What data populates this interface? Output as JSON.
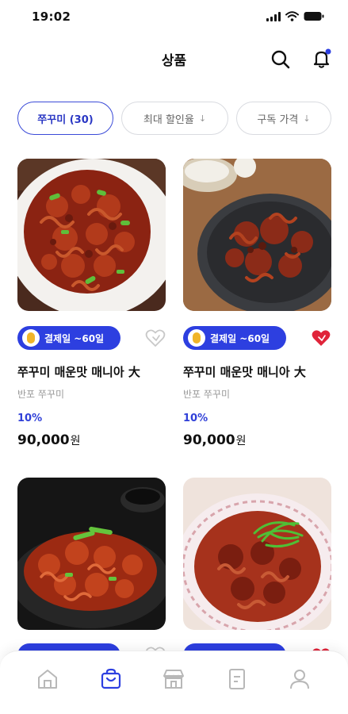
{
  "status_bar": {
    "time": "19:02"
  },
  "header": {
    "title": "상품"
  },
  "filters": [
    {
      "label": "쭈꾸미 (30)",
      "active": true
    },
    {
      "label": "최대 할인율",
      "active": false,
      "has_arrow": true
    },
    {
      "label": "구독 가격",
      "active": false,
      "has_arrow": true
    }
  ],
  "products": [
    {
      "badge": "결제일 ~60일",
      "liked": false,
      "name": "쭈꾸미 매운맛 매니아 大",
      "brand": "반포 쭈꾸미",
      "discount": "10%",
      "price": "90,000",
      "price_unit": "원"
    },
    {
      "badge": "결제일 ~60일",
      "liked": true,
      "name": "쭈꾸미 매운맛 매니아 大",
      "brand": "반포 쭈꾸미",
      "discount": "10%",
      "price": "90,000",
      "price_unit": "원"
    },
    {
      "liked": false
    },
    {
      "liked": true
    }
  ],
  "tabbar": {
    "items": [
      "home-icon",
      "shopping-bag-icon",
      "store-icon",
      "document-icon",
      "profile-icon"
    ],
    "active_index": 1
  },
  "colors": {
    "accent": "#2d3fe0",
    "heart_active": "#e0243a",
    "text_primary": "#111111",
    "text_muted": "#9a9a9a"
  }
}
